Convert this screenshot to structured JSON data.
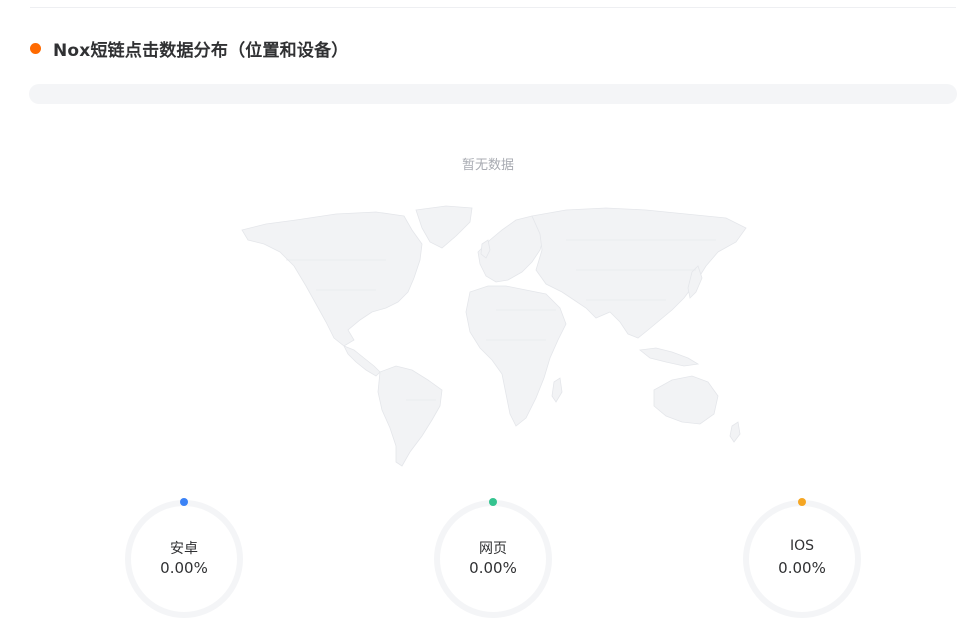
{
  "section": {
    "title": "Nox短链点击数据分布（位置和设备）"
  },
  "map": {
    "empty_text": "暂无数据"
  },
  "devices": [
    {
      "label": "安卓",
      "value": "0.00%",
      "color": "#3b82f6"
    },
    {
      "label": "网页",
      "value": "0.00%",
      "color": "#34c38f"
    },
    {
      "label": "IOS",
      "value": "0.00%",
      "color": "#f5a623"
    }
  ]
}
